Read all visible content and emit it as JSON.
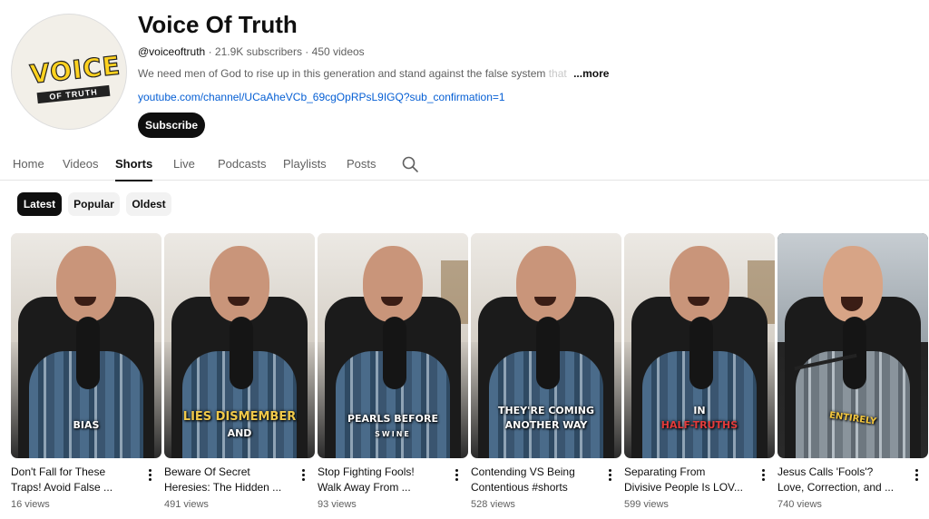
{
  "channel": {
    "title": "Voice Of Truth",
    "handle": "@voiceoftruth",
    "subscribers": "21.9K subscribers",
    "videos": "450 videos",
    "description_visible": "We need men of God to rise up in this generation and stand against the false system",
    "description_faded": " that",
    "more_label": "...more",
    "link": "youtube.com/channel/UCaAheVCb_69cgOpRPsL9IGQ?sub_confirmation=1",
    "subscribe_label": "Subscribe",
    "avatar_logo_text": "VOICE",
    "avatar_band_text": "OF TRUTH"
  },
  "tabs": [
    {
      "label": "Home"
    },
    {
      "label": "Videos"
    },
    {
      "label": "Shorts",
      "active": true
    },
    {
      "label": "Live"
    },
    {
      "label": "Podcasts"
    },
    {
      "label": "Playlists"
    },
    {
      "label": "Posts"
    }
  ],
  "filters": [
    {
      "label": "Latest",
      "active": true
    },
    {
      "label": "Popular"
    },
    {
      "label": "Oldest"
    }
  ],
  "shorts": [
    {
      "title_line1": "Don't Fall for These",
      "title_line2": "Traps! Avoid False ...",
      "views": "16 views",
      "caption1": "BIAS",
      "caption2": ""
    },
    {
      "title_line1": "Beware Of Secret",
      "title_line2": "Heresies: The Hidden ...",
      "views": "491 views",
      "caption1": "LIES DISMEMBER",
      "caption2": "AND"
    },
    {
      "title_line1": "Stop Fighting Fools!",
      "title_line2": "Walk Away From ...",
      "views": "93 views",
      "caption1": "PEARLS BEFORE",
      "caption2": "SWINE"
    },
    {
      "title_line1": "Contending VS Being",
      "title_line2": "Contentious #shorts",
      "views": "528 views",
      "caption1": "THEY'RE COMING",
      "caption2": "ANOTHER WAY"
    },
    {
      "title_line1": "Separating From",
      "title_line2": "Divisive People Is LOV...",
      "views": "599 views",
      "caption1": "IN",
      "caption2": "HALF-TRUTHS"
    },
    {
      "title_line1": "Jesus Calls 'Fools'?",
      "title_line2": "Love, Correction, and ...",
      "views": "740 views",
      "caption1": "ENTIRELY",
      "caption2": ""
    }
  ],
  "icons": {
    "search": "search-icon",
    "more": "more-vert-icon"
  },
  "colors": {
    "accent": "#0f0f0f",
    "link": "#065fd4",
    "secondary_text": "#606060",
    "caption_yellow": "#f0c94a",
    "caption_red": "#e23b3b"
  }
}
